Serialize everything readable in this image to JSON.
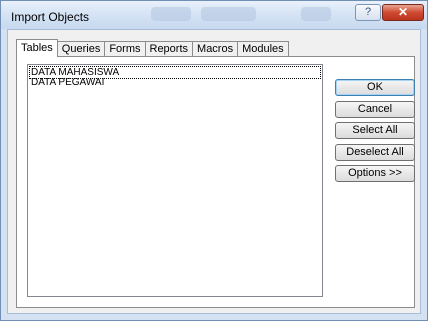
{
  "window": {
    "title": "Import Objects",
    "help_glyph": "?",
    "close_glyph": "✕"
  },
  "tabs": [
    {
      "label": "Tables",
      "active": true
    },
    {
      "label": "Queries"
    },
    {
      "label": "Forms"
    },
    {
      "label": "Reports"
    },
    {
      "label": "Macros"
    },
    {
      "label": "Modules"
    }
  ],
  "list": {
    "items": [
      "DATA MAHASISWA",
      "DATA PEGAWAI"
    ]
  },
  "buttons": {
    "ok": "OK",
    "cancel": "Cancel",
    "select_all": "Select All",
    "deselect_all": "Deselect All",
    "options": "Options >>"
  },
  "colors": {
    "frame": "#d4e1f2",
    "close_button": "#c8412a",
    "default_button_border": "#3c7fb1"
  },
  "icons": {
    "help": "help-icon",
    "close": "close-icon"
  }
}
